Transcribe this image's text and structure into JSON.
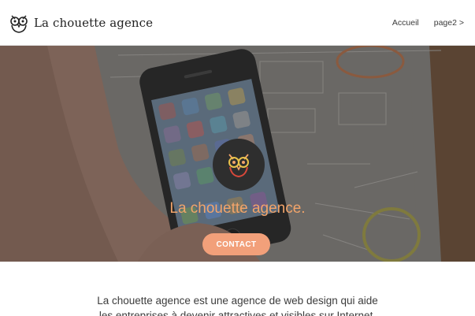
{
  "header": {
    "brand_name": "La chouette agence",
    "nav": [
      "Accueil",
      "page2 >"
    ]
  },
  "hero": {
    "title": "La chouette agence.",
    "cta_label": "CONTACT"
  },
  "intro": {
    "line1": "La chouette agence est une agence de web design qui aide",
    "line2": "les entreprises à devenir attractives et visibles sur Internet."
  },
  "colors": {
    "accent": "#f2a46a",
    "button": "#f2a07a",
    "badge": "#2e2e2e"
  }
}
